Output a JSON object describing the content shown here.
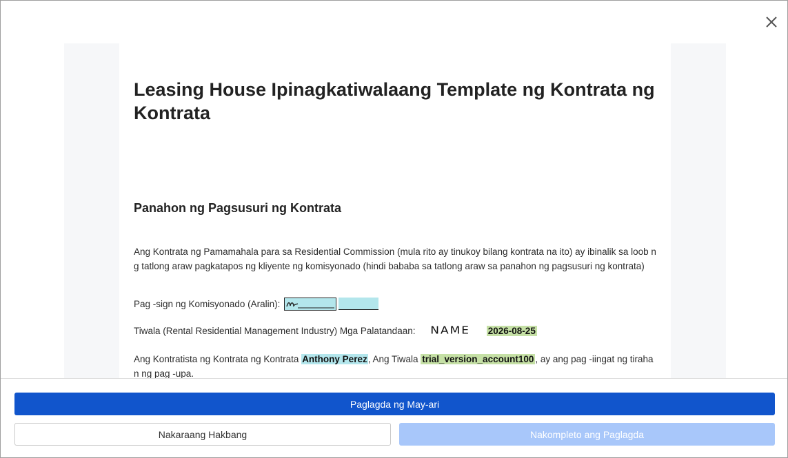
{
  "document": {
    "title": "Leasing House Ipinagkatiwalaang Template ng Kontrata ng Kontrata",
    "section_heading": "Panahon ng Pagsusuri ng Kontrata",
    "paragraph_1": "Ang Kontrata ng Pamamahala para sa Residential Commission (mula rito ay tinukoy bilang kontrata na ito) ay ibinalik sa loob ng tatlong araw pagkatapos ng kliyente ng komisyonado (hindi bababa sa tatlong araw sa panahon ng pagsusuri ng kontrata)",
    "sign_label": "Pag -sign ng Komisyonado (Aralin):",
    "trust_label": "Tiwala (Rental Residential Management Industry) Mga Palatandaan:",
    "stamp_text": "NAME",
    "date": "2026-08-25",
    "p4_text_1": "Ang Kontratista ng Kontrata ng Kontrata",
    "contractor_name": "Anthony Perez",
    "p4_text_2": ", Ang Tiwala",
    "account_name": "trial_version_account100",
    "p4_text_3": ", ay ang pag -iingat ng tirahan ng pag -upa."
  },
  "buttons": {
    "owner_sign": "Paglagda ng May-ari",
    "previous_step": "Nakaraang Hakbang",
    "complete_signing": "Nakompleto ang Paglagda"
  },
  "colors": {
    "primary": "#1155cc",
    "disabled": "#a8c7fa",
    "highlight_blue": "#b3e6ec",
    "highlight_green": "#c5e0a5"
  },
  "icons": {
    "close": "close-icon"
  }
}
